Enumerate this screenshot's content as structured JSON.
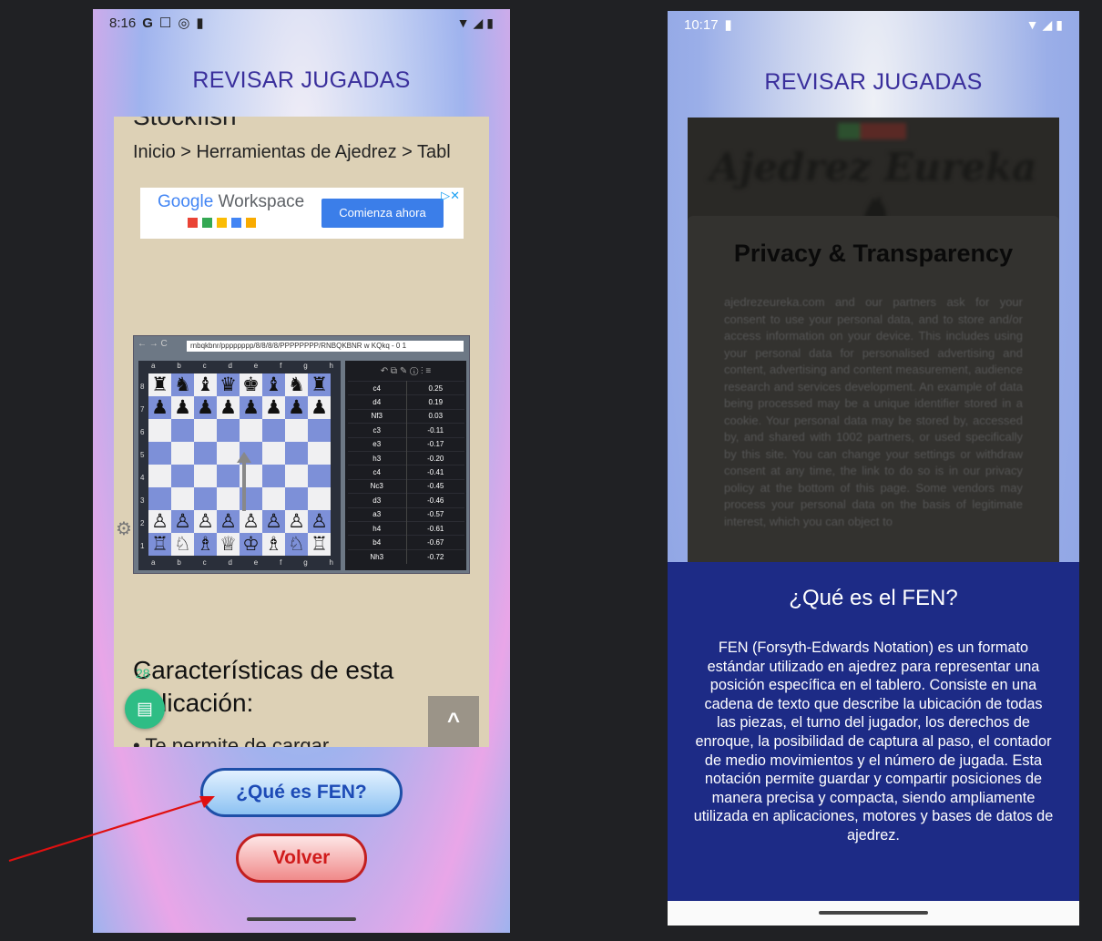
{
  "left_screen": {
    "status": {
      "time": "8:16",
      "left_icons": [
        "G",
        "☐",
        "◎",
        "▮"
      ],
      "right_icons": [
        "wifi-icon",
        "signal-icon",
        "battery-icon"
      ]
    },
    "app_title": "REVISAR JUGADAS",
    "web": {
      "cut_title": "Stockfish",
      "breadcrumb": "Inicio > Herramientas de Ajedrez > Tabl",
      "ad": {
        "brand_google": "Google",
        "brand_product": "Workspace",
        "cta": "Comienza ahora",
        "choices": "▷✕"
      },
      "board_shot": {
        "url": "rnbqkbnr/pppppppp/8/8/8/8/PPPPPPPP/RNBQKBNR w KQkq - 0 1",
        "nav": "← → C",
        "files": [
          "a",
          "b",
          "c",
          "d",
          "e",
          "f",
          "g",
          "h"
        ],
        "ranks": [
          "8",
          "7",
          "6",
          "5",
          "4",
          "3",
          "2",
          "1"
        ],
        "position": [
          [
            "♜",
            "♞",
            "♝",
            "♛",
            "♚",
            "♝",
            "♞",
            "♜"
          ],
          [
            "♟",
            "♟",
            "♟",
            "♟",
            "♟",
            "♟",
            "♟",
            "♟"
          ],
          [
            "",
            "",
            "",
            "",
            "",
            "",
            "",
            ""
          ],
          [
            "",
            "",
            "",
            "",
            "",
            "",
            "",
            ""
          ],
          [
            "",
            "",
            "",
            "",
            "",
            "",
            "",
            ""
          ],
          [
            "",
            "",
            "",
            "",
            "",
            "",
            "",
            ""
          ],
          [
            "♙",
            "♙",
            "♙",
            "♙",
            "♙",
            "♙",
            "♙",
            "♙"
          ],
          [
            "♖",
            "♘",
            "♗",
            "♕",
            "♔",
            "♗",
            "♘",
            "♖"
          ]
        ],
        "engine_tools": "↶ ⧉ ✎ ⓘ ⫶ ≡",
        "engine_moves": [
          [
            "c4",
            "0.25"
          ],
          [
            "d4",
            "0.19"
          ],
          [
            "Nf3",
            "0.03"
          ],
          [
            "c3",
            "-0.11"
          ],
          [
            "e3",
            "-0.17"
          ],
          [
            "h3",
            "-0.20"
          ],
          [
            "c4",
            "-0.41"
          ],
          [
            "Nc3",
            "-0.45"
          ],
          [
            "d3",
            "-0.46"
          ],
          [
            "a3",
            "-0.57"
          ],
          [
            "h4",
            "-0.61"
          ],
          [
            "b4",
            "-0.67"
          ],
          [
            "Nh3",
            "-0.72"
          ]
        ]
      },
      "features_title": "Características de esta aplicación:",
      "cut_bullet": "• Te permite de cargar",
      "chat_count": "28",
      "scroll_top_icon": "^"
    },
    "buttons": {
      "fen": "¿Qué es FEN?",
      "back": "Volver"
    }
  },
  "right_screen": {
    "status": {
      "time": "10:17",
      "right_icons": [
        "wifi-icon",
        "signal-icon",
        "battery-icon"
      ]
    },
    "app_title": "REVISAR JUGADAS",
    "web": {
      "logo": "Ajedrez Eureka ♞",
      "privacy_title": "Privacy & Transparency",
      "privacy_body": "ajedrezeureka.com and our partners ask for your consent to use your personal data, and to store and/or access information on your device. This includes using your personal data for personalised advertising and content, advertising and content measurement, audience research and services development. An example of data being processed may be a unique identifier stored in a cookie. Your personal data may be stored by, accessed by, and shared with 1002 partners, or used specifically by this site. You can change your settings or withdraw consent at any time, the link to do so is in our privacy policy at the bottom of this page. Some vendors may process your personal data on the basis of legitimate interest, which you can object to"
    },
    "fen_panel": {
      "title": "¿Qué es el FEN?",
      "body": "FEN (Forsyth-Edwards Notation) es un formato estándar utilizado en ajedrez para representar una posición específica en el tablero. Consiste en una cadena de texto que describe la ubicación de todas las piezas, el turno del jugador, los derechos de enroque, la posibilidad de captura al paso, el contador de medio movimientos y el número de jugada. Esta notación permite guardar y compartir posiciones de manera precisa y compacta, siendo ampliamente utilizada en aplicaciones, motores y bases de datos de ajedrez."
    }
  },
  "colors": {
    "title_purple": "#3a2f9c",
    "fen_panel_bg": "#1d2b86",
    "fen_button_border": "#1e4fa8",
    "back_button_border": "#c21f1f",
    "annotation_arrow": "#e01010"
  }
}
